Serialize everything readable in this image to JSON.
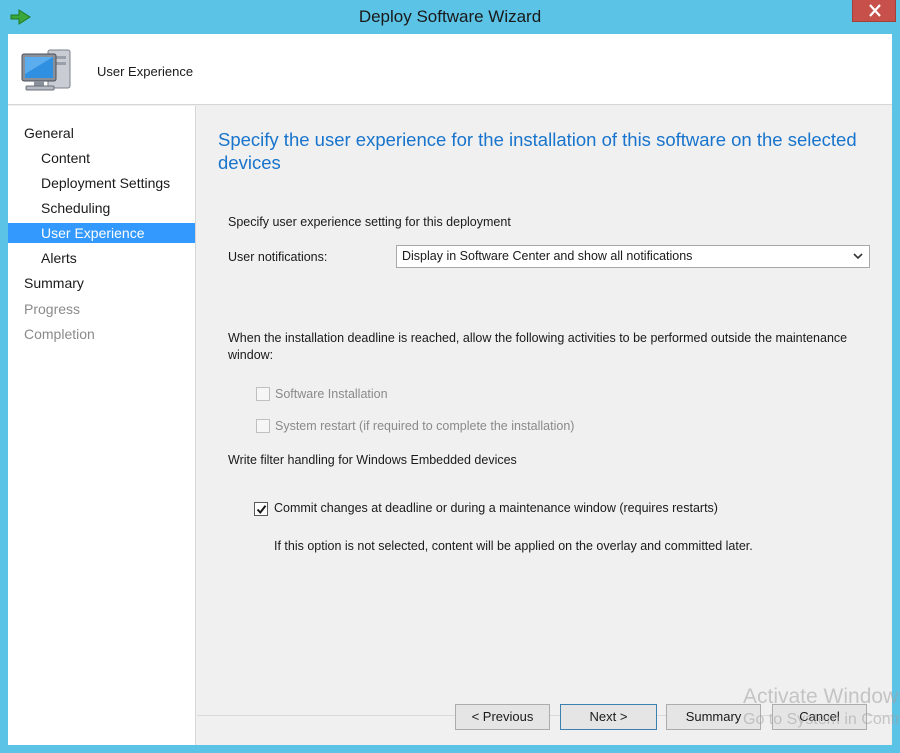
{
  "window": {
    "title": "Deploy Software Wizard"
  },
  "banner": {
    "title": "User Experience"
  },
  "nav": {
    "items": [
      {
        "label": "General",
        "state": "normal"
      },
      {
        "label": "Content",
        "state": "normal"
      },
      {
        "label": "Deployment Settings",
        "state": "normal"
      },
      {
        "label": "Scheduling",
        "state": "normal"
      },
      {
        "label": "User Experience",
        "state": "selected"
      },
      {
        "label": "Alerts",
        "state": "normal"
      },
      {
        "label": "Summary",
        "state": "normal"
      },
      {
        "label": "Progress",
        "state": "disabled"
      },
      {
        "label": "Completion",
        "state": "disabled"
      }
    ]
  },
  "content": {
    "heading": "Specify the user experience for the installation of this software on the selected devices",
    "section_label": "Specify user experience setting for this deployment",
    "notifications_label": "User notifications:",
    "notifications_value": "Display in Software Center and show all notifications",
    "deadline_text": "When the installation deadline is reached, allow the following activities to be performed outside the maintenance window:",
    "software_installation_label": "Software Installation",
    "software_installation_checked": false,
    "system_restart_label": "System restart  (if required to complete the installation)",
    "system_restart_checked": false,
    "write_filter_label": "Write filter handling for Windows Embedded devices",
    "commit_label": "Commit changes at deadline or during a maintenance window (requires restarts)",
    "commit_checked": true,
    "commit_note": "If this option is not selected, content will be applied on the overlay and committed later."
  },
  "buttons": {
    "previous": "< Previous",
    "next": "Next >",
    "summary": "Summary",
    "cancel": "Cancel"
  },
  "watermark": {
    "line1": "Activate Windows",
    "line2": "Go to System in Control Panel to activate Windows."
  },
  "colors": {
    "frame": "#5bc3e6",
    "heading": "#1874cc",
    "selection": "#3399ff",
    "close": "#c7504a"
  }
}
